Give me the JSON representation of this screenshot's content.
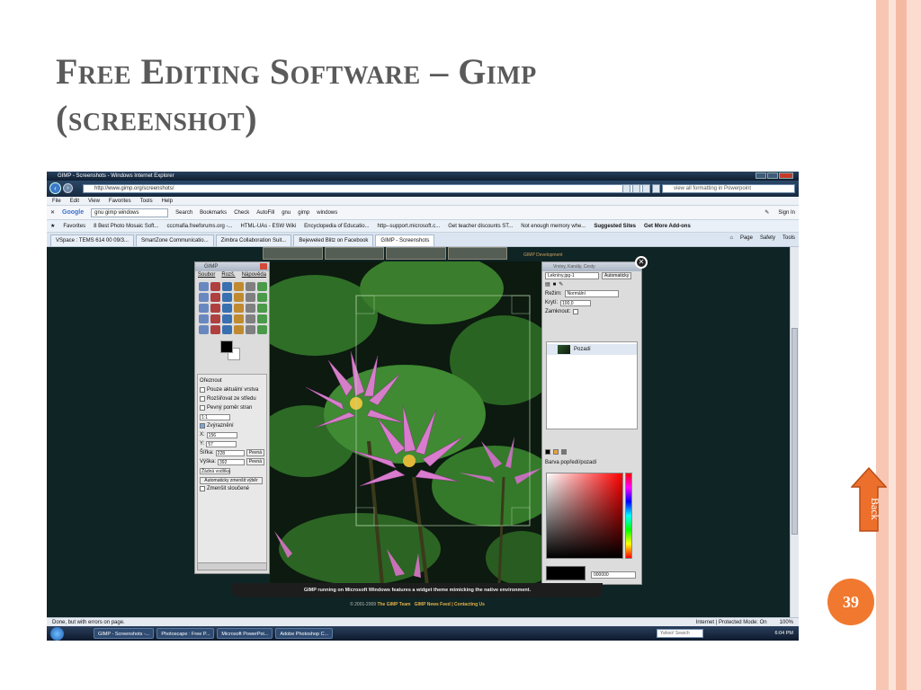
{
  "slide": {
    "title": "Free Editing Software – Gimp (screenshot)",
    "back_label": "Back",
    "page_number": "39"
  },
  "browser": {
    "window_title": "GIMP - Screenshots - Windows Internet Explorer",
    "url": "http://www.gimp.org/screenshots/",
    "search_box": "view all formatting in Powerpoint",
    "menu": [
      "File",
      "Edit",
      "View",
      "Favorites",
      "Tools",
      "Help"
    ],
    "google_toolbar": {
      "logo": "Google",
      "query": "gnu gimp windows",
      "items": [
        "Search",
        "Bookmarks",
        "Check",
        "AutoFill",
        "gnu",
        "gimp",
        "windows"
      ],
      "sign_in": "Sign In"
    },
    "favorites": {
      "label": "Favorites",
      "items": [
        "8 Best Photo Mosaic Soft...",
        "cccmafia.freeforums.org -...",
        "HTML-UAs - ESW Wiki",
        "Encyclopedia of Educatio...",
        "http--support.microsoft.c...",
        "Get teacher discounts ST...",
        "Not enough memory whe..."
      ],
      "suggested": "Suggested Sites",
      "addons": "Get More Add-ons"
    },
    "tabs": [
      "VSpace : TEMS 614 00 09/3...",
      "SmartZone Communicatio...",
      "Zimbra Collaboration Suit...",
      "Bejeweled Blitz on Facebook",
      "GIMP - Screenshots"
    ],
    "tab_tools": [
      "Page",
      "Safety",
      "Tools"
    ],
    "status_text": "Done, but with errors on page.",
    "status_zone": "Internet | Protected Mode: On",
    "zoom": "100%"
  },
  "gimp_page": {
    "dev_link": "GIMP Development",
    "caption": "GIMP running on Microsoft Windows features a widget theme mimicking the native environment.",
    "footer_copy": "© 2001-2009",
    "footer_team": "The GIMP Team",
    "footer_links": "GIMP News Feed | Contacting Us"
  },
  "toolbox": {
    "title": "GIMP",
    "menu": [
      "Soubor",
      "Rozš.",
      "Nápověda"
    ],
    "options_title": "Ořeznout",
    "opt1": "Pouze aktuální vrstva",
    "opt2": "Rozšiřovat ze středu",
    "opt3": "Pevný poměr stran",
    "ratio": "1:1",
    "highlight": "Zvýraznění",
    "x_val": "156",
    "y_val": "57",
    "w_label": "Šířka:",
    "w_val": "228",
    "h_label": "Výška:",
    "h_val": "392",
    "fixed_btn": "Pevná",
    "guides": "Žádná vodítka",
    "auto_btn": "Automaticky zmenšit výběr",
    "merge": "Zmenšit sloučené"
  },
  "dock": {
    "title": "Vrstvy, Kanály, Cesty",
    "image_select": "Lekníny.jpg-1",
    "auto": "Automaticky",
    "mode_label": "Režim:",
    "mode_val": "Normální",
    "opacity_label": "Krytí:",
    "opacity_val": "100,0",
    "lock_label": "Zamknout:",
    "layer_name": "Pozadí",
    "color_title": "Barva popředí/pozadí",
    "hex_val": "000000"
  },
  "taskbar": {
    "items": [
      "GIMP - Screenshots -...",
      "Photoscape : Free P...",
      "Microsoft PowerPoi...",
      "Adobe Photoshop C..."
    ],
    "yahoo": "Yahoo! Search",
    "clock": "6:04 PM"
  },
  "colors": {
    "accent_orange": "#f0792f",
    "title_gray": "#5a5a5a",
    "page_bg": "#0f2424"
  }
}
